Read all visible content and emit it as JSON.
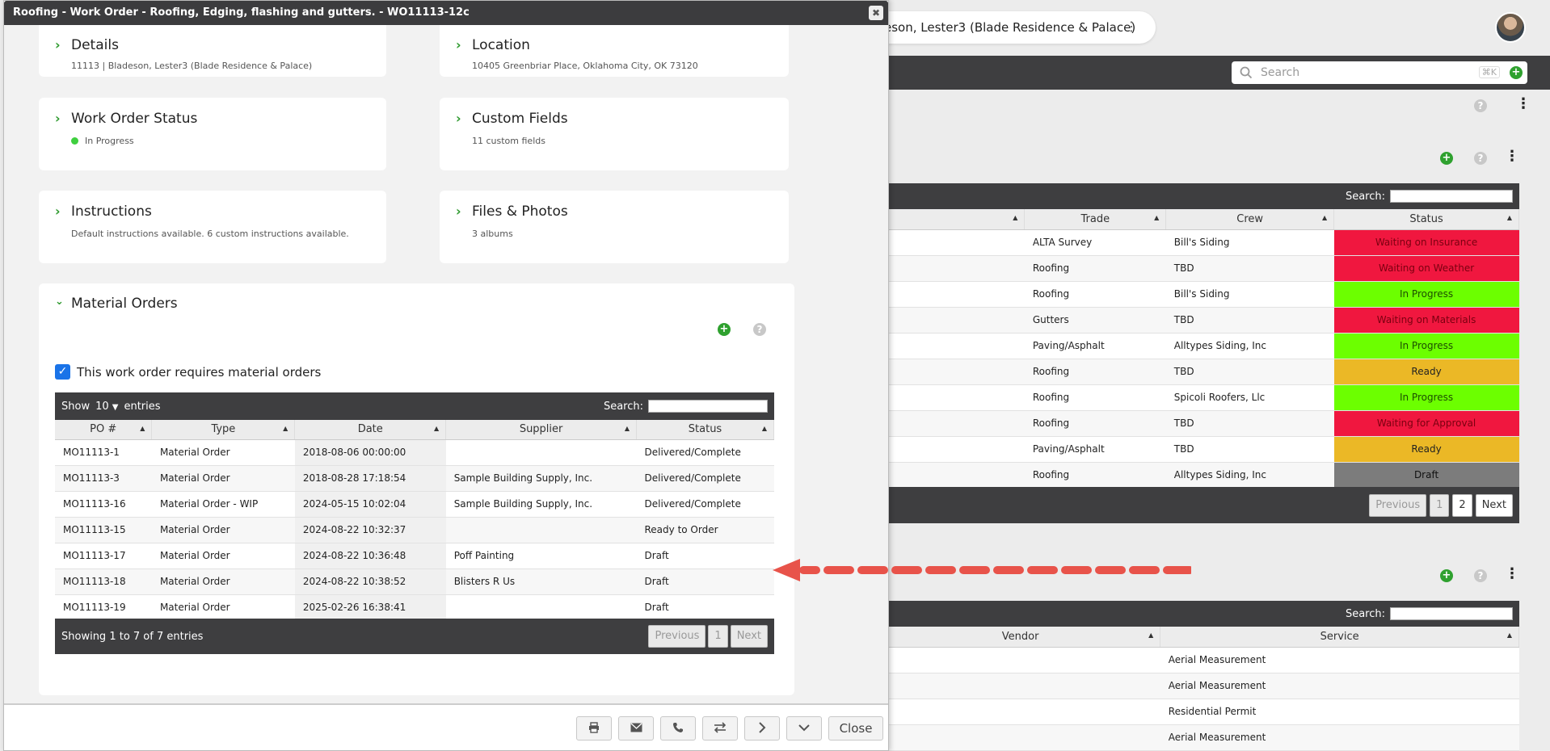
{
  "background": {
    "context_title": "eson, Lester3 (Blade Residence & Palace)",
    "menu_glyph": "⋮",
    "search_placeholder": "Search",
    "search_shortcut": "⌘K",
    "jobs_table": {
      "search_label": "Search:",
      "columns": [
        "",
        "Trade",
        "Crew",
        "Status"
      ],
      "rows": [
        {
          "trade": "ALTA Survey",
          "crew": "Bill's Siding",
          "status": "Waiting on Insurance",
          "color": "#f0173f",
          "text_color": "#7a0010"
        },
        {
          "trade": "Roofing",
          "crew": "TBD",
          "status": "Waiting on Weather",
          "color": "#f0173f",
          "text_color": "#7a0010"
        },
        {
          "trade": "Roofing",
          "crew": "Bill's Siding",
          "status": "In Progress",
          "color": "#6cff00",
          "text_color": "#1c4d00"
        },
        {
          "trade": "Gutters",
          "crew": "TBD",
          "status": "Waiting on Materials",
          "color": "#f0173f",
          "text_color": "#7a0010"
        },
        {
          "trade": "Paving/Asphalt",
          "crew": "Alltypes Siding, Inc",
          "status": "In Progress",
          "color": "#6cff00",
          "text_color": "#1c4d00"
        },
        {
          "trade": "Roofing",
          "crew": "TBD",
          "status": "Ready",
          "color": "#ebb826",
          "text_color": "#222"
        },
        {
          "trade": "Roofing",
          "crew": "Spicoli Roofers, Llc",
          "status": "In Progress",
          "color": "#6cff00",
          "text_color": "#1c4d00"
        },
        {
          "trade": "Roofing",
          "crew": "TBD",
          "status": "Waiting for Approval",
          "color": "#f0173f",
          "text_color": "#7a0010"
        },
        {
          "trade": "Paving/Asphalt",
          "crew": "TBD",
          "status": "Ready",
          "color": "#ebb826",
          "text_color": "#222"
        },
        {
          "trade": "Roofing",
          "crew": "Alltypes Siding, Inc",
          "status": "Draft",
          "color": "#7c7c7c",
          "text_color": "#111"
        }
      ],
      "pagination": {
        "previous": "Previous",
        "pages": [
          "1",
          "2"
        ],
        "next": "Next"
      }
    },
    "vendors_table": {
      "search_label": "Search:",
      "columns": [
        "Vendor",
        "Service"
      ],
      "rows": [
        {
          "service": "Aerial Measurement"
        },
        {
          "service": "Aerial Measurement"
        },
        {
          "service": "Residential Permit"
        },
        {
          "service": "Aerial Measurement"
        }
      ]
    }
  },
  "modal": {
    "title": "Roofing - Work Order - Roofing, Edging, flashing and gutters. - WO11113-12c",
    "close_glyph": "✖",
    "cards": {
      "details": {
        "title": "Details",
        "sub": "11113 | Bladeson, Lester3 (Blade Residence & Palace)"
      },
      "location": {
        "title": "Location",
        "sub": "10405 Greenbriar Place, Oklahoma City, OK 73120"
      },
      "status": {
        "title": "Work Order Status",
        "sub": "In Progress"
      },
      "custom": {
        "title": "Custom Fields",
        "sub": "11 custom fields"
      },
      "instructions": {
        "title": "Instructions",
        "sub": "Default instructions available. 6 custom instructions available."
      },
      "files": {
        "title": "Files & Photos",
        "sub": "3 albums"
      }
    },
    "material_orders": {
      "title": "Material Orders",
      "requires_label": "This work order requires material orders",
      "show_label": "Show",
      "page_size": "10",
      "entries_label": "entries",
      "search_label": "Search:",
      "columns": [
        "PO #",
        "Type",
        "Date",
        "Supplier",
        "Status"
      ],
      "rows": [
        {
          "po": "MO11113-1",
          "type": "Material Order",
          "date": "2018-08-06 00:00:00",
          "supplier": "",
          "status": "Delivered/Complete"
        },
        {
          "po": "MO11113-3",
          "type": "Material Order",
          "date": "2018-08-28 17:18:54",
          "supplier": "Sample Building Supply, Inc.",
          "status": "Delivered/Complete"
        },
        {
          "po": "MO11113-16",
          "type": "Material Order - WIP",
          "date": "2024-05-15 10:02:04",
          "supplier": "Sample Building Supply, Inc.",
          "status": "Delivered/Complete"
        },
        {
          "po": "MO11113-15",
          "type": "Material Order",
          "date": "2024-08-22 10:32:37",
          "supplier": "",
          "status": "Ready to Order"
        },
        {
          "po": "MO11113-17",
          "type": "Material Order",
          "date": "2024-08-22 10:36:48",
          "supplier": "Poff Painting",
          "status": "Draft"
        },
        {
          "po": "MO11113-18",
          "type": "Material Order",
          "date": "2024-08-22 10:38:52",
          "supplier": "Blisters R Us",
          "status": "Draft"
        },
        {
          "po": "MO11113-19",
          "type": "Material Order",
          "date": "2025-02-26 16:38:41",
          "supplier": "",
          "status": "Draft"
        }
      ],
      "summary": "Showing 1 to 7 of 7 entries",
      "pagination": {
        "previous": "Previous",
        "page": "1",
        "next": "Next"
      }
    },
    "footer": {
      "close_label": "Close"
    }
  }
}
